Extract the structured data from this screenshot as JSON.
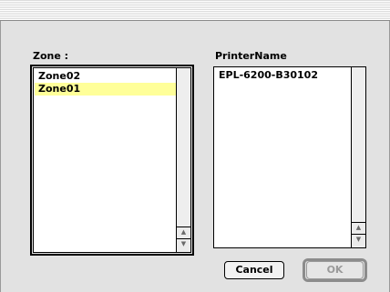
{
  "dialog": {
    "zone_label": "Zone :",
    "printer_label": "PrinterName",
    "zones": [
      {
        "label": "Zone02",
        "selected": false
      },
      {
        "label": "Zone01",
        "selected": true
      }
    ],
    "printers": [
      {
        "label": "EPL-6200-B30102"
      }
    ],
    "cancel_label": "Cancel",
    "ok_label": "OK",
    "ok_enabled": false,
    "scroll_up_icon": "triangle-up",
    "scroll_down_icon": "triangle-down",
    "selection_color": "#ffff99"
  }
}
